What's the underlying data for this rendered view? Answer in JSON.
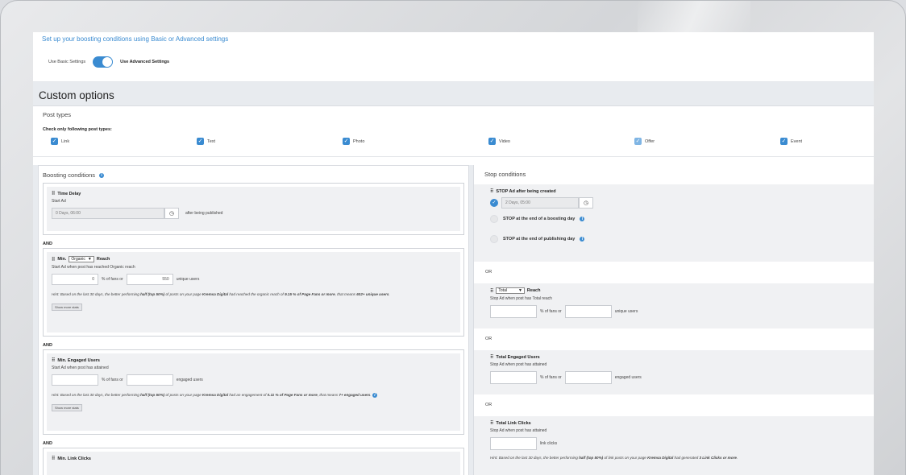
{
  "intro": {
    "link_text": "Set up your boosting conditions using Basic or Advanced settings",
    "basic_label": "Use Basic Settings",
    "advanced_label": "Use Advanced Settings",
    "advanced_enabled": true
  },
  "custom": {
    "title": "Custom options",
    "post_types_title": "Post types",
    "post_types_sub": "Check only following post types:",
    "post_types": [
      {
        "label": "Link",
        "checked": true
      },
      {
        "label": "Text",
        "checked": true
      },
      {
        "label": "Photo",
        "checked": true
      },
      {
        "label": "Video",
        "checked": true
      },
      {
        "label": "Offer",
        "checked": true
      },
      {
        "label": "Event",
        "checked": true
      }
    ]
  },
  "boosting": {
    "title": "Boosting conditions",
    "and_label": "AND",
    "time_delay": {
      "title": "Time Delay",
      "sub": "Start Ad",
      "value": "0 Days, 06:00",
      "suffix": "after being published"
    },
    "min_reach": {
      "prefix": "Min.",
      "select": "Organic",
      "suffix": "Reach",
      "sub": "Start Ad when post has reached Organic reach",
      "percent_value": "0",
      "percent_label": "% of fans or",
      "users_value": "550",
      "users_label": "unique users",
      "hint_1": "Hint: Based on the last 30 days, the better performing ",
      "hint_2": "half (top 50%)",
      "hint_3": " of posts on your page ",
      "hint_4": "Kremsa Digital",
      "hint_5": " had reached the organic reach of ",
      "hint_6": "9.15 % of Page Fans or more",
      "hint_7": ", that means ",
      "hint_8": "602+ unique users",
      "hint_9": ".",
      "more_stats": "Show more stats"
    },
    "min_engaged": {
      "title": "Min. Engaged Users",
      "sub": "Start Ad when post has attained",
      "percent_label": "% of fans or",
      "users_label": "engaged users",
      "hint_1": "Hint: Based on the last 30 days, the better performing ",
      "hint_2": "half (top 50%)",
      "hint_3": " of posts on your page ",
      "hint_4": "Kremsa Digital",
      "hint_5": " had an engagement of ",
      "hint_6": "0.11 % of Page Fans or more",
      "hint_7": ", that means ",
      "hint_8": "7+ engaged users",
      "hint_9": ".",
      "more_stats": "Show more stats"
    },
    "min_link_clicks": {
      "title": "Min. Link Clicks"
    }
  },
  "stop": {
    "title": "Stop conditions",
    "or_label": "OR",
    "stop_ad": {
      "title": "STOP Ad after being created",
      "value": "2 Days, 05:00",
      "opt_boosting_day": "STOP at the end of a boosting day",
      "opt_publishing_day": "STOP at the end of publishing day"
    },
    "reach": {
      "select": "Total",
      "suffix": "Reach",
      "sub": "Stop Ad when post has Total reach",
      "percent_label": "% of fans or",
      "users_label": "unique users"
    },
    "engaged": {
      "title": "Total Engaged Users",
      "sub": "Stop Ad when post has attained",
      "percent_label": "% of fans or",
      "users_label": "engaged users"
    },
    "link_clicks": {
      "title": "Total Link Clicks",
      "sub": "Stop Ad when post has attained",
      "clicks_label": "link clicks",
      "hint_1": "Hint: Based on the last 30 days, the better performing ",
      "hint_2": "half (top 50%)",
      "hint_3": " of link posts on your page ",
      "hint_4": "Kremsa Digital",
      "hint_5": " had generated ",
      "hint_6": "3 Link Clicks or more",
      "hint_7": "."
    }
  }
}
